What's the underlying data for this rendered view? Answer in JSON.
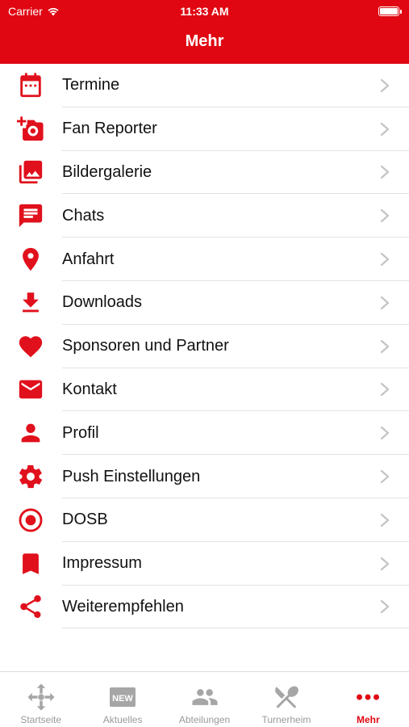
{
  "status_bar": {
    "carrier": "Carrier",
    "time": "11:33 AM"
  },
  "header": {
    "title": "Mehr",
    "background": "#e00712"
  },
  "accent_color": "#e0101c",
  "menu": [
    {
      "label": "Termine",
      "icon": "calendar-icon"
    },
    {
      "label": "Fan Reporter",
      "icon": "add-photo-icon"
    },
    {
      "label": "Bildergalerie",
      "icon": "photo-library-icon"
    },
    {
      "label": "Chats",
      "icon": "chat-icon"
    },
    {
      "label": "Anfahrt",
      "icon": "location-pin-icon"
    },
    {
      "label": "Downloads",
      "icon": "download-icon"
    },
    {
      "label": "Sponsoren und Partner",
      "icon": "heart-icon"
    },
    {
      "label": "Kontakt",
      "icon": "mail-icon"
    },
    {
      "label": "Profil",
      "icon": "person-icon"
    },
    {
      "label": "Push Einstellungen",
      "icon": "gear-icon"
    },
    {
      "label": "DOSB",
      "icon": "target-icon"
    },
    {
      "label": "Impressum",
      "icon": "bookmark-icon"
    },
    {
      "label": "Weiterempfehlen",
      "icon": "share-icon"
    }
  ],
  "tabbar": [
    {
      "label": "Startseite",
      "icon": "move-arrows-icon",
      "active": false
    },
    {
      "label": "Aktuelles",
      "icon": "new-badge-icon",
      "badge_text": "NEW",
      "active": false
    },
    {
      "label": "Abteilungen",
      "icon": "people-icon",
      "active": false
    },
    {
      "label": "Turnerheim",
      "icon": "fork-knife-icon",
      "active": false
    },
    {
      "label": "Mehr",
      "icon": "more-dots-icon",
      "active": true
    }
  ]
}
